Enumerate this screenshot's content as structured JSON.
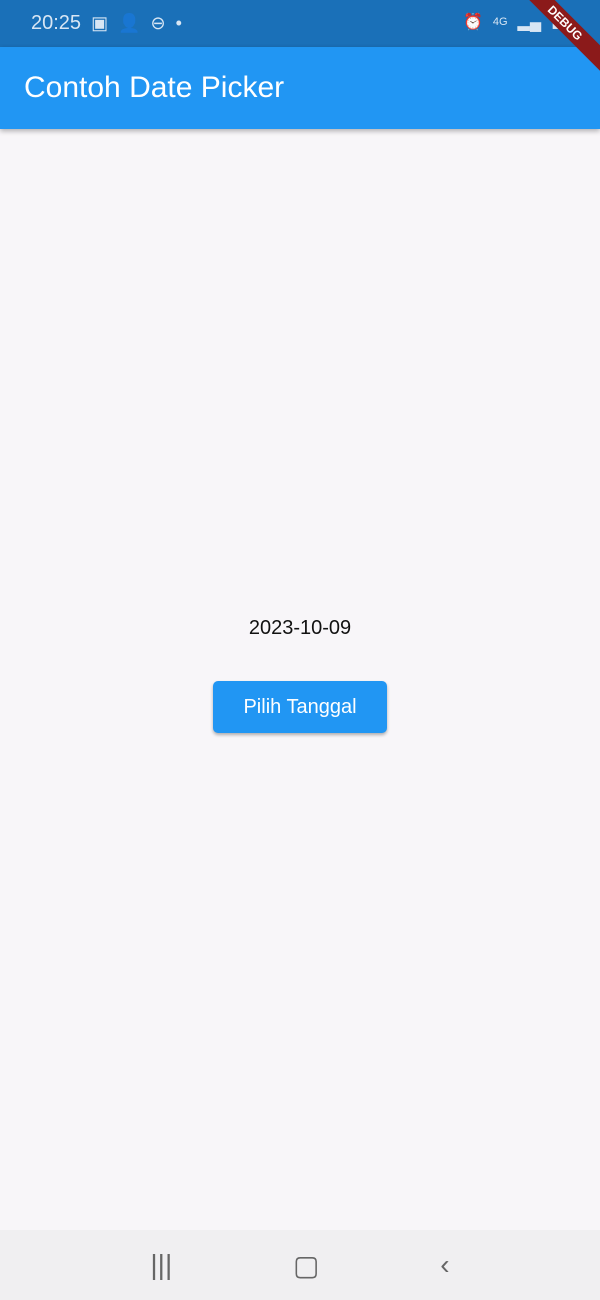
{
  "status": {
    "time": "20:25",
    "network": "4G"
  },
  "app": {
    "title": "Contoh Date Picker",
    "debug_banner": "DEBUG"
  },
  "main": {
    "date": "2023-10-09",
    "button_label": "Pilih Tanggal"
  }
}
